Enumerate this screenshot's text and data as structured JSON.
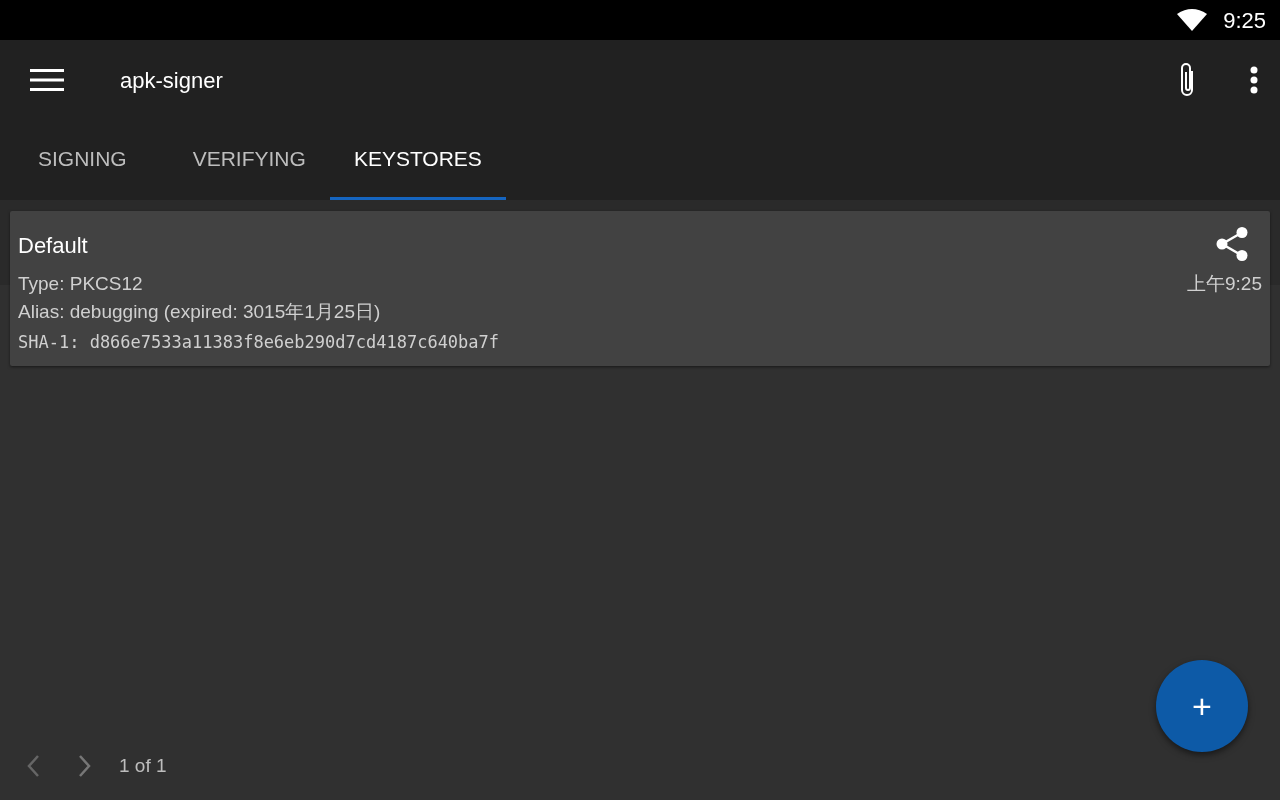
{
  "status_bar": {
    "time": "9:25"
  },
  "toolbar": {
    "title": "apk-signer"
  },
  "tabs": [
    {
      "label": "SIGNING",
      "selected": false
    },
    {
      "label": "VERIFYING",
      "selected": false
    },
    {
      "label": "KEYSTORES",
      "selected": true
    }
  ],
  "keystores": [
    {
      "name": "Default",
      "type": "Type: PKCS12",
      "alias": "Alias: debugging (expired: 3015年1月25日)",
      "sha1": "SHA-1: d866e7533a11383f8e6eb290d7cd4187c640ba7f",
      "time": "上午9:25"
    }
  ],
  "pager": {
    "text": "1 of 1"
  },
  "fab": {
    "label": "+"
  }
}
